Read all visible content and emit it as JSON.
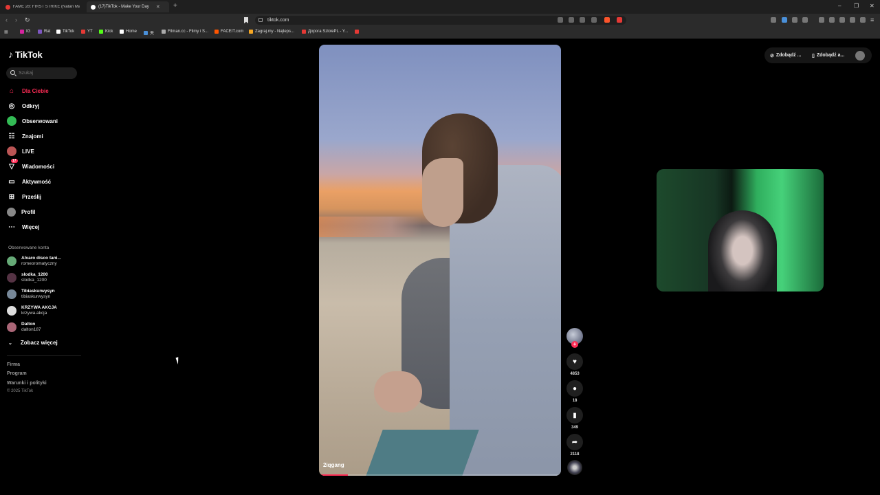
{
  "browser": {
    "tabs": [
      {
        "label": "FAME 28: FIRST STRIKE (Natan Marc...",
        "icon": "youtube-icon",
        "color": "#e53935"
      },
      {
        "label": "(17)TikTok - Make Your Day",
        "icon": "tiktok-icon",
        "color": "#ffffff"
      }
    ],
    "url": "tiktok.com",
    "bookmarks": [
      {
        "label": "IG",
        "color": "#d6249f"
      },
      {
        "label": "Rat",
        "color": "#7e57c2"
      },
      {
        "label": "TikTok",
        "color": "#ffffff"
      },
      {
        "label": "YT",
        "color": "#e53935"
      },
      {
        "label": "Kick",
        "color": "#53fc18"
      },
      {
        "label": "Home",
        "color": "#ffffff"
      },
      {
        "label": "天",
        "color": "#4a90d9"
      },
      {
        "label": "Filman.cc - Filmy i S...",
        "color": "#aaaaaa"
      },
      {
        "label": "FACEIT.com",
        "color": "#ff5500"
      },
      {
        "label": "Zagraj.my - Najleps...",
        "color": "#f5a623"
      },
      {
        "label": "Дорога SzlolePL - Y...",
        "color": "#e53935"
      },
      {
        "label": "",
        "color": "#e53935"
      }
    ]
  },
  "sidebar": {
    "logo": "TikTok",
    "search_placeholder": "Szukaj",
    "nav": [
      {
        "label": "Dla Ciebie",
        "icon": "home-icon",
        "active": true
      },
      {
        "label": "Odkryj",
        "icon": "compass-icon"
      },
      {
        "label": "Obserwowani",
        "icon": "following-icon"
      },
      {
        "label": "Znajomi",
        "icon": "friends-icon"
      },
      {
        "label": "LIVE",
        "icon": "live-icon"
      },
      {
        "label": "Wiadomości",
        "icon": "messages-icon",
        "badge": "17"
      },
      {
        "label": "Aktywność",
        "icon": "activity-icon"
      },
      {
        "label": "Prześlij",
        "icon": "upload-icon"
      },
      {
        "label": "Profil",
        "icon": "profile-icon"
      },
      {
        "label": "Więcej",
        "icon": "more-icon"
      }
    ],
    "followed_title": "Obserwowane konta",
    "accounts": [
      {
        "name": "Alvaro disco tani...",
        "handle": "romeoromatyczny"
      },
      {
        "name": "slodka_1200",
        "handle": "slodka_1200"
      },
      {
        "name": "Tibiaskurwysyn",
        "handle": "tibiaskurwysyn"
      },
      {
        "name": "KRZYWA AKCJA",
        "handle": "krzywa.akcja"
      },
      {
        "name": "Dalton",
        "handle": "dalton187"
      }
    ],
    "see_more": "Zobacz więcej",
    "footer": [
      "Firma",
      "Program",
      "Warunki i polityki"
    ],
    "copyright": "© 2025 TikTok"
  },
  "video": {
    "author": "2iqgang",
    "progress": 0.12
  },
  "actions": {
    "likes": "4853",
    "comments": "18",
    "saves": "349",
    "shares": "2118"
  },
  "topright": {
    "get_coins": "Zdobądź ...",
    "get_app": "Zdobądź a..."
  }
}
